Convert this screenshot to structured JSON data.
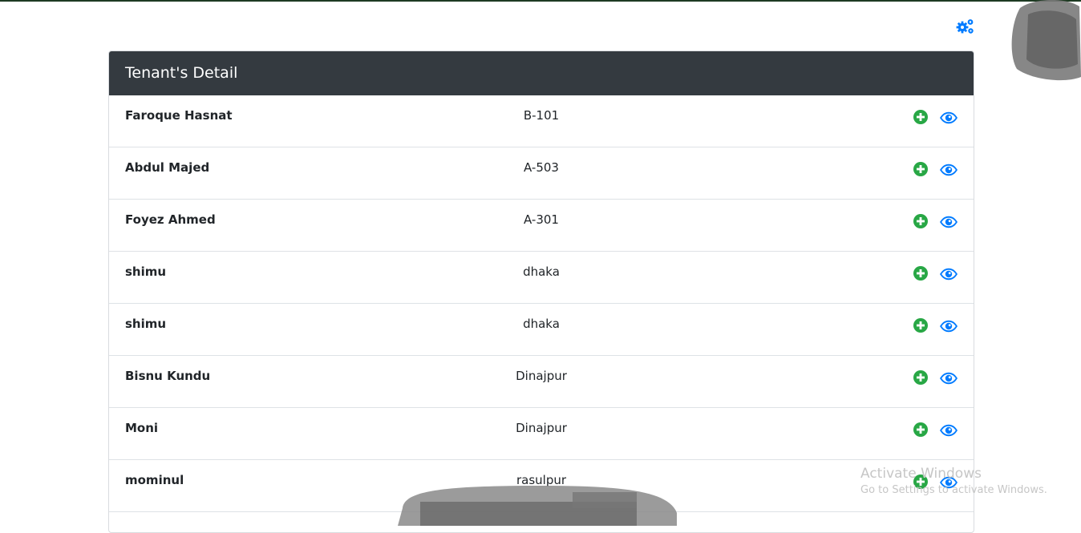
{
  "header": {
    "title": "Tenant's Detail"
  },
  "toolbar": {
    "settings_icon": "gears-icon"
  },
  "icons": {
    "add": "plus-circle-icon",
    "view": "eye-icon"
  },
  "colors": {
    "header_bg": "#343a40",
    "add": "#28a745",
    "view": "#007bff",
    "gear": "#007bff"
  },
  "tenants": [
    {
      "name": "Faroque Hasnat",
      "unit": "B-101"
    },
    {
      "name": "Abdul Majed",
      "unit": "A-503"
    },
    {
      "name": "Foyez Ahmed",
      "unit": "A-301"
    },
    {
      "name": "shimu",
      "unit": "dhaka"
    },
    {
      "name": "shimu",
      "unit": "dhaka"
    },
    {
      "name": "Bisnu Kundu",
      "unit": "Dinajpur"
    },
    {
      "name": "Moni",
      "unit": "Dinajpur"
    },
    {
      "name": "mominul",
      "unit": "rasulpur"
    }
  ],
  "watermark": {
    "title": "Activate Windows",
    "subtitle": "Go to Settings to activate Windows."
  }
}
